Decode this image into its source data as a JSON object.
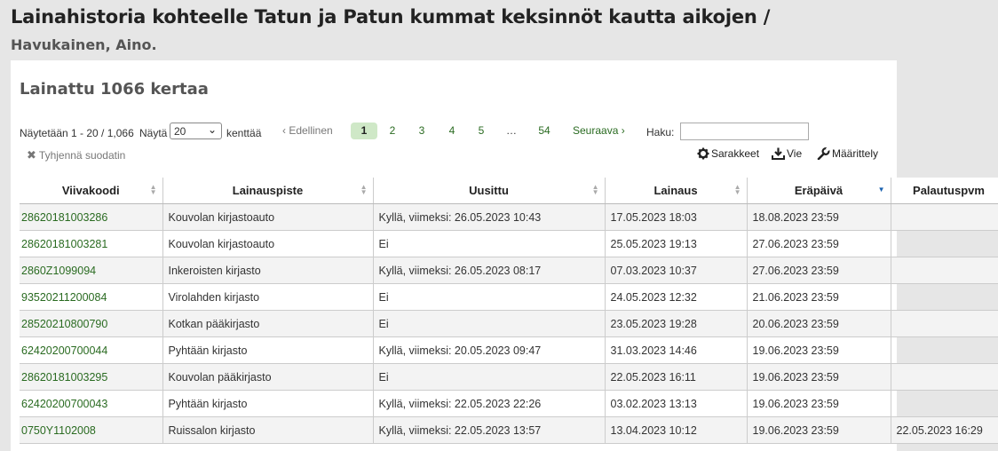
{
  "page": {
    "title": "Lainahistoria kohteelle Tatun ja Patun kummat keksinnöt kautta aikojen /",
    "subtitle": "Havukainen, Aino."
  },
  "panel": {
    "heading": "Lainattu 1066 kertaa",
    "info": "Näytetään 1 - 20 / 1,066",
    "show_label": "Näytä",
    "page_size": "20",
    "entries_label": "kenttää",
    "prev": "‹ Edellinen",
    "pages": [
      "1",
      "2",
      "3",
      "4",
      "5",
      "…",
      "54"
    ],
    "next": "Seuraava ›",
    "search_label": "Haku:",
    "search_value": "",
    "clear_filter": "Tyhjennä suodatin",
    "btn_columns": "Sarakkeet",
    "btn_export": "Vie",
    "btn_config": "Määrittely"
  },
  "table": {
    "headers": [
      "Viivakoodi",
      "Lainauspiste",
      "Uusittu",
      "Lainaus",
      "Eräpäivä",
      "Palautuspvm"
    ],
    "rows": [
      [
        "28620181003286",
        "Kouvolan kirjastoauto",
        "Kyllä, viimeksi: 26.05.2023 10:43",
        "17.05.2023 18:03",
        "18.08.2023 23:59",
        ""
      ],
      [
        "28620181003281",
        "Kouvolan kirjastoauto",
        "Ei",
        "25.05.2023 19:13",
        "27.06.2023 23:59",
        ""
      ],
      [
        "2860Z1099094",
        "Inkeroisten kirjasto",
        "Kyllä, viimeksi: 26.05.2023 08:17",
        "07.03.2023 10:37",
        "27.06.2023 23:59",
        ""
      ],
      [
        "93520211200084",
        "Virolahden kirjasto",
        "Ei",
        "24.05.2023 12:32",
        "21.06.2023 23:59",
        ""
      ],
      [
        "28520210800790",
        "Kotkan pääkirjasto",
        "Ei",
        "23.05.2023 19:28",
        "20.06.2023 23:59",
        ""
      ],
      [
        "62420200700044",
        "Pyhtään kirjasto",
        "Kyllä, viimeksi: 20.05.2023 09:47",
        "31.03.2023 14:46",
        "19.06.2023 23:59",
        ""
      ],
      [
        "28620181003295",
        "Kouvolan pääkirjasto",
        "Ei",
        "22.05.2023 16:11",
        "19.06.2023 23:59",
        ""
      ],
      [
        "62420200700043",
        "Pyhtään kirjasto",
        "Kyllä, viimeksi: 22.05.2023 22:26",
        "03.02.2023 13:13",
        "19.06.2023 23:59",
        ""
      ],
      [
        "0750Y1102008",
        "Ruissalon kirjasto",
        "Kyllä, viimeksi: 22.05.2023 13:57",
        "13.04.2023 10:12",
        "19.06.2023 23:59",
        "22.05.2023 16:29"
      ]
    ]
  }
}
